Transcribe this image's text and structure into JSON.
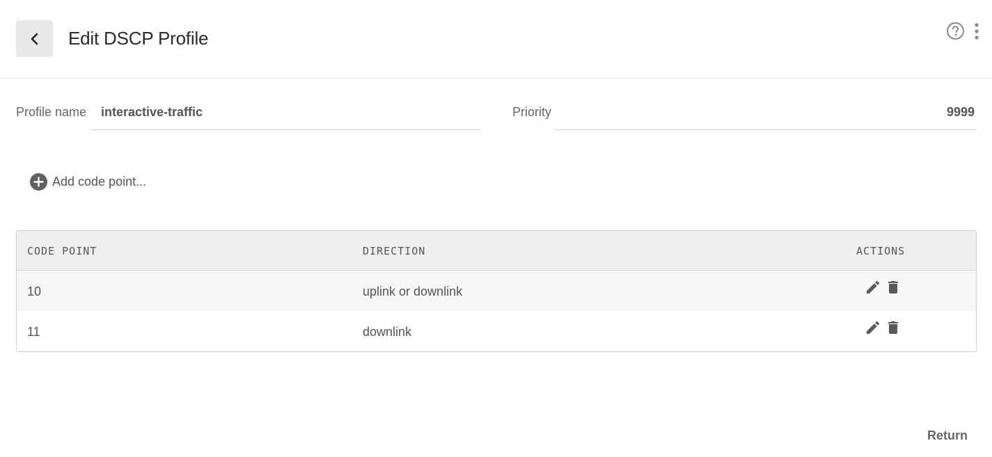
{
  "header": {
    "title": "Edit DSCP Profile",
    "back_icon": "chevron-left-icon",
    "help_icon": "help-circle-icon",
    "more_icon": "more-vert-icon"
  },
  "form": {
    "profile_name_label": "Profile name",
    "profile_name_value": "interactive-traffic",
    "priority_label": "Priority",
    "priority_value": "9999"
  },
  "add_code_point": {
    "label": "Add code point...",
    "icon": "add-circle-icon"
  },
  "table": {
    "columns": [
      "CODE POINT",
      "DIRECTION",
      "ACTIONS"
    ],
    "rows": [
      {
        "code_point": "10",
        "direction": "uplink or downlink"
      },
      {
        "code_point": "11",
        "direction": "downlink"
      }
    ],
    "action_icons": [
      "edit-icon",
      "delete-icon"
    ]
  },
  "footer": {
    "return_label": "Return"
  }
}
